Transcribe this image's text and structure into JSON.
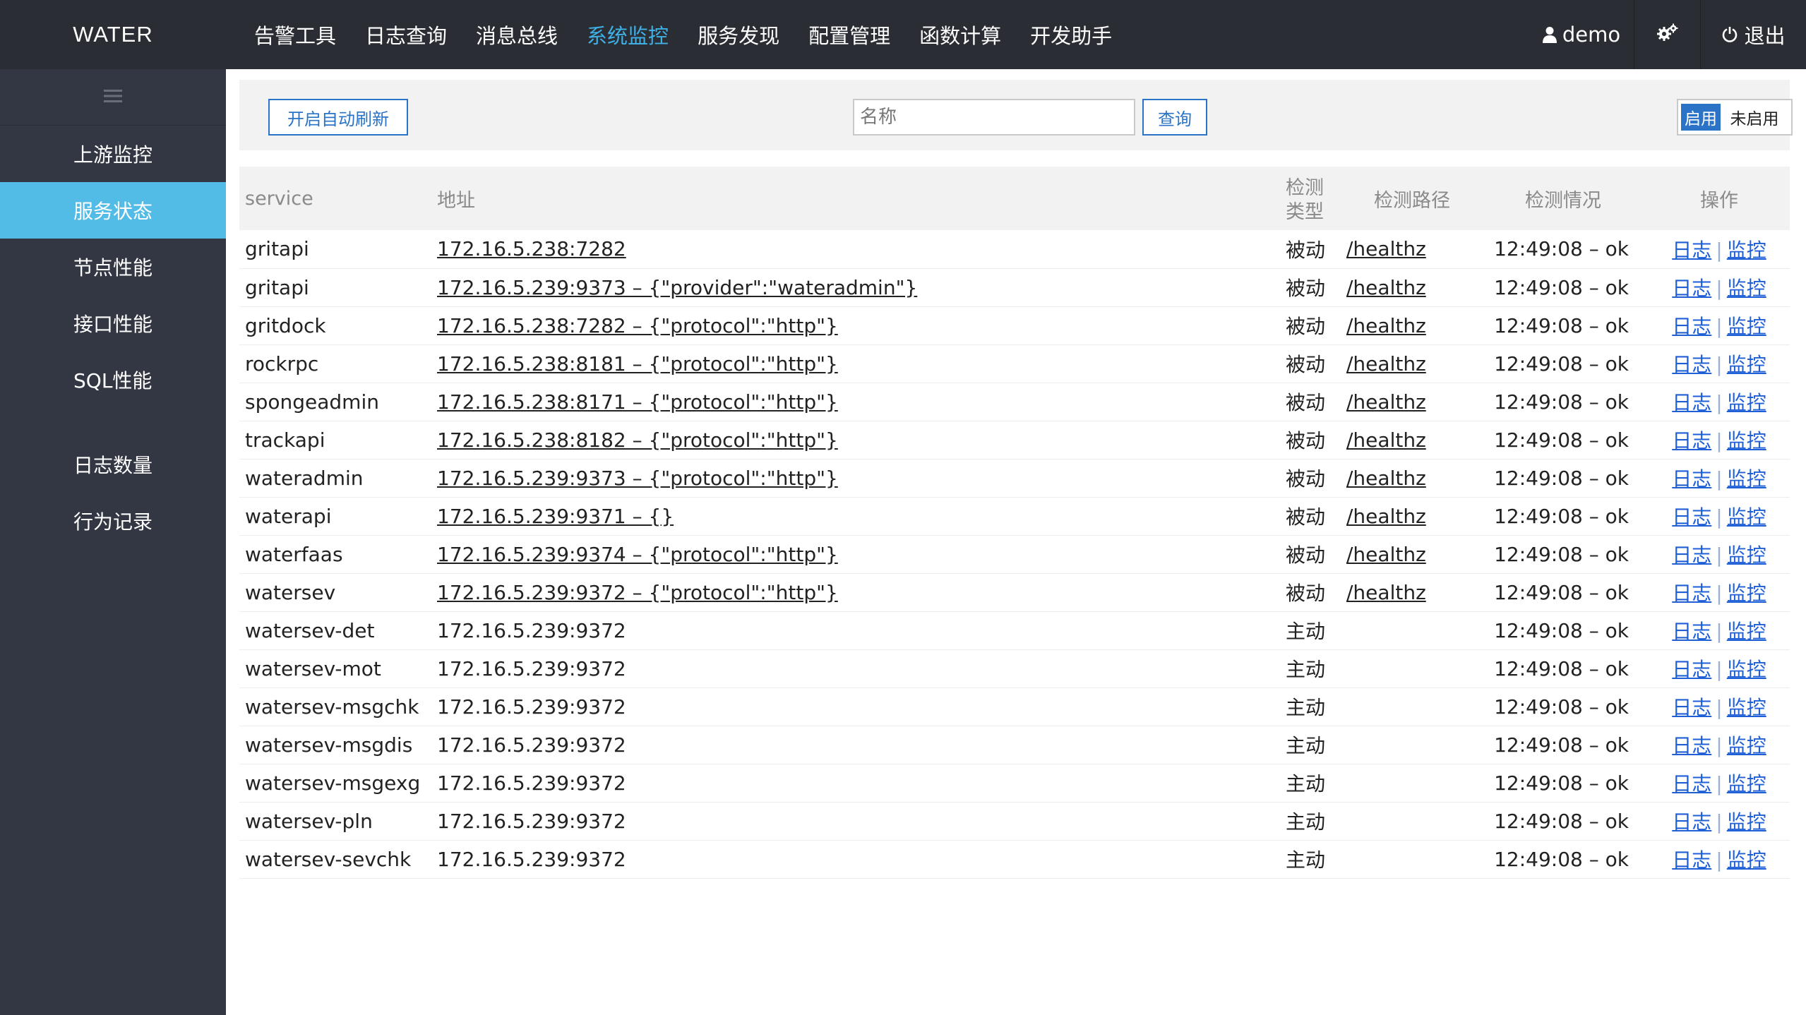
{
  "brand": "WATER",
  "nav": [
    {
      "label": "告警工具",
      "active": false
    },
    {
      "label": "日志查询",
      "active": false
    },
    {
      "label": "消息总线",
      "active": false
    },
    {
      "label": "系统监控",
      "active": true
    },
    {
      "label": "服务发现",
      "active": false
    },
    {
      "label": "配置管理",
      "active": false
    },
    {
      "label": "函数计算",
      "active": false
    },
    {
      "label": "开发助手",
      "active": false
    }
  ],
  "top_right": {
    "user_label": "demo",
    "user_icon": "user-icon",
    "settings_icon": "gears-icon",
    "logout_label": "退出",
    "logout_icon": "power-icon"
  },
  "sidebar": {
    "toggle_icon": "hamburger-icon",
    "group1": [
      "上游监控",
      "服务状态",
      "节点性能",
      "接口性能",
      "SQL性能"
    ],
    "group2": [
      "日志数量",
      "行为记录"
    ],
    "active": "服务状态"
  },
  "toolbar": {
    "refresh_label": "开启自动刷新",
    "search_placeholder": "名称",
    "search_value": "",
    "query_label": "查询",
    "toggle_on": "启用",
    "toggle_off": "未启用"
  },
  "table": {
    "headers": {
      "service": "service",
      "address": "地址",
      "type_line1": "检测",
      "type_line2": "类型",
      "path": "检测路径",
      "check": "检测情况",
      "ops": "操作"
    },
    "op_log": "日志",
    "op_monitor": "监控",
    "rows": [
      {
        "service": "gritapi",
        "address": "172.16.5.238:7282",
        "addr_link": true,
        "type": "被动",
        "path": "/healthz",
        "check": "12:49:08 – ok"
      },
      {
        "service": "gritapi",
        "address": "172.16.5.239:9373 – {\"provider\":\"wateradmin\"}",
        "addr_link": true,
        "type": "被动",
        "path": "/healthz",
        "check": "12:49:08 – ok"
      },
      {
        "service": "gritdock",
        "address": "172.16.5.238:7282 – {\"protocol\":\"http\"}",
        "addr_link": true,
        "type": "被动",
        "path": "/healthz",
        "check": "12:49:08 – ok"
      },
      {
        "service": "rockrpc",
        "address": "172.16.5.238:8181 – {\"protocol\":\"http\"}",
        "addr_link": true,
        "type": "被动",
        "path": "/healthz",
        "check": "12:49:08 – ok"
      },
      {
        "service": "spongeadmin",
        "address": "172.16.5.238:8171 – {\"protocol\":\"http\"}",
        "addr_link": true,
        "type": "被动",
        "path": "/healthz",
        "check": "12:49:08 – ok"
      },
      {
        "service": "trackapi",
        "address": "172.16.5.238:8182 – {\"protocol\":\"http\"}",
        "addr_link": true,
        "type": "被动",
        "path": "/healthz",
        "check": "12:49:08 – ok"
      },
      {
        "service": "wateradmin",
        "address": "172.16.5.239:9373 – {\"protocol\":\"http\"}",
        "addr_link": true,
        "type": "被动",
        "path": "/healthz",
        "check": "12:49:08 – ok"
      },
      {
        "service": "waterapi",
        "address": "172.16.5.239:9371 – {}",
        "addr_link": true,
        "type": "被动",
        "path": "/healthz",
        "check": "12:49:08 – ok"
      },
      {
        "service": "waterfaas",
        "address": "172.16.5.239:9374 – {\"protocol\":\"http\"}",
        "addr_link": true,
        "type": "被动",
        "path": "/healthz",
        "check": "12:49:08 – ok"
      },
      {
        "service": "watersev",
        "address": "172.16.5.239:9372 – {\"protocol\":\"http\"}",
        "addr_link": true,
        "type": "被动",
        "path": "/healthz",
        "check": "12:49:08 – ok"
      },
      {
        "service": "watersev-det",
        "address": "172.16.5.239:9372",
        "addr_link": false,
        "type": "主动",
        "path": "",
        "check": "12:49:08 – ok"
      },
      {
        "service": "watersev-mot",
        "address": "172.16.5.239:9372",
        "addr_link": false,
        "type": "主动",
        "path": "",
        "check": "12:49:08 – ok"
      },
      {
        "service": "watersev-msgchk",
        "address": "172.16.5.239:9372",
        "addr_link": false,
        "type": "主动",
        "path": "",
        "check": "12:49:08 – ok"
      },
      {
        "service": "watersev-msgdis",
        "address": "172.16.5.239:9372",
        "addr_link": false,
        "type": "主动",
        "path": "",
        "check": "12:49:08 – ok"
      },
      {
        "service": "watersev-msgexg",
        "address": "172.16.5.239:9372",
        "addr_link": false,
        "type": "主动",
        "path": "",
        "check": "12:49:08 – ok"
      },
      {
        "service": "watersev-pln",
        "address": "172.16.5.239:9372",
        "addr_link": false,
        "type": "主动",
        "path": "",
        "check": "12:49:08 – ok"
      },
      {
        "service": "watersev-sevchk",
        "address": "172.16.5.239:9372",
        "addr_link": false,
        "type": "主动",
        "path": "",
        "check": "12:49:08 – ok"
      }
    ]
  },
  "colors": {
    "topbar_bg": "#2b2d34",
    "sidebar_bg": "#333743",
    "sidebar_active": "#53bce6",
    "nav_active": "#3fb0e6",
    "primary_blue": "#2a73c6",
    "op_link": "#1f5fd6"
  }
}
